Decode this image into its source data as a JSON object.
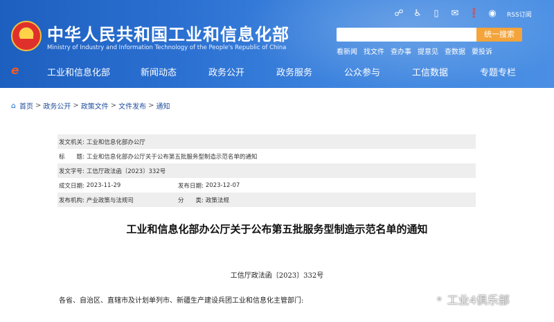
{
  "header": {
    "title": "中华人民共和国工业和信息化部",
    "subtitle": "Ministry of Industry and Information Technology of the People's Republic of China",
    "top_icons": [
      "mobile-app-icon",
      "accessibility-icon",
      "phone-icon",
      "mail-icon",
      "message-icon",
      "weibo-icon"
    ],
    "rss_label": "RSS订阅",
    "search_placeholder": "",
    "search_button": "统一搜索",
    "quick_links": [
      "看新闻",
      "找文件",
      "查办事",
      "提意见",
      "查数据",
      "要投诉"
    ]
  },
  "nav": {
    "items": [
      "工业和信息化部",
      "新闻动态",
      "政务公开",
      "政务服务",
      "公众参与",
      "工信数据",
      "专题专栏"
    ]
  },
  "breadcrumb": [
    "首页",
    "政务公开",
    "政策文件",
    "文件发布",
    "通知"
  ],
  "meta": {
    "issuer_label": "发文机关:",
    "issuer": "工业和信息化部办公厅",
    "title_label": "标　　题:",
    "title": "工业和信息化部办公厅关于公布第五批服务型制造示范名单的通知",
    "doc_no_label": "发文字号:",
    "doc_no": "工信厅政法函〔2023〕332号",
    "created_label": "成文日期:",
    "created": "2023-11-29",
    "published_label": "发布日期:",
    "published": "2023-12-07",
    "org_label": "发布机构:",
    "org": "产业政策与法规司",
    "category_label": "分　　类:",
    "category": "政策法规"
  },
  "document": {
    "title": "工业和信息化部办公厅关于公布第五批服务型制造示范名单的通知",
    "number": "工信厅政法函〔2023〕332号",
    "greeting": "各省、自治区、直辖市及计划单列市、新疆生产建设兵团工业和信息化主管部门:"
  },
  "watermark": {
    "text": "工业4俱乐部"
  },
  "colors": {
    "header_blue": "#2a6fd0",
    "search_button": "#f3a43a",
    "link_blue": "#1f4e9c"
  }
}
